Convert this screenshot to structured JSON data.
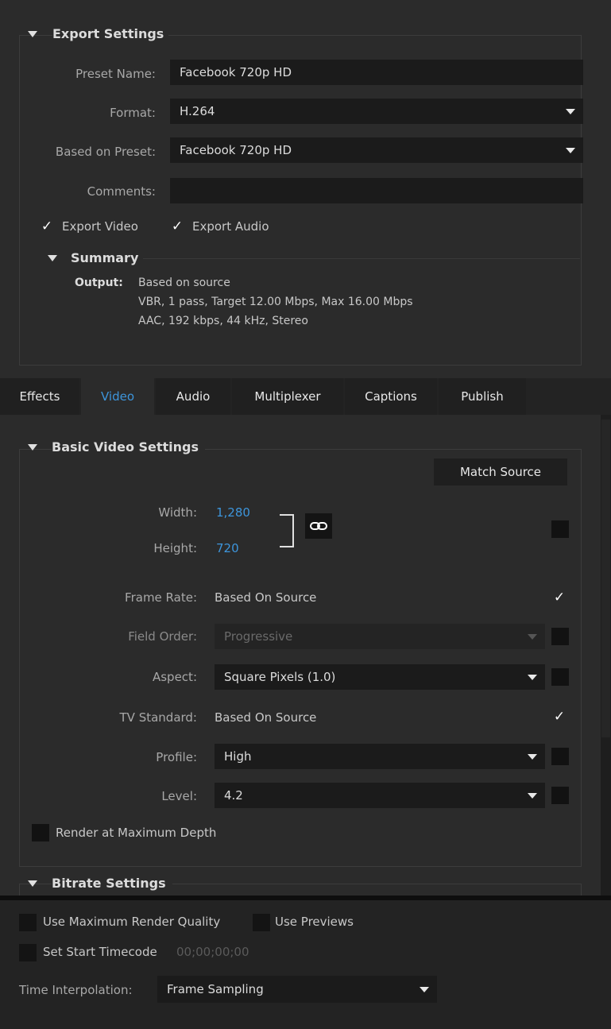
{
  "export_settings": {
    "title": "Export Settings",
    "preset_name_label": "Preset Name:",
    "preset_name_value": "Facebook 720p HD",
    "format_label": "Format:",
    "format_value": "H.264",
    "based_on_preset_label": "Based on Preset:",
    "based_on_preset_value": "Facebook 720p HD",
    "comments_label": "Comments:",
    "comments_value": "",
    "export_video_label": "Export Video",
    "export_video_checked": true,
    "export_audio_label": "Export Audio",
    "export_audio_checked": true,
    "summary": {
      "title": "Summary",
      "output_label": "Output:",
      "output_line1": "Based on source",
      "output_line2": "VBR, 1 pass, Target 12.00 Mbps, Max 16.00 Mbps",
      "output_line3": "AAC, 192 kbps, 44 kHz, Stereo"
    }
  },
  "tabs": [
    {
      "label": "Effects",
      "active": false
    },
    {
      "label": "Video",
      "active": true
    },
    {
      "label": "Audio",
      "active": false
    },
    {
      "label": "Multiplexer",
      "active": false
    },
    {
      "label": "Captions",
      "active": false
    },
    {
      "label": "Publish",
      "active": false
    }
  ],
  "basic_video": {
    "title": "Basic Video Settings",
    "match_source_label": "Match Source",
    "width_label": "Width:",
    "width_value": "1,280",
    "height_label": "Height:",
    "height_value": "720",
    "frame_rate_label": "Frame Rate:",
    "frame_rate_value": "Based On Source",
    "field_order_label": "Field Order:",
    "field_order_value": "Progressive",
    "aspect_label": "Aspect:",
    "aspect_value": "Square Pixels (1.0)",
    "tv_standard_label": "TV Standard:",
    "tv_standard_value": "Based On Source",
    "profile_label": "Profile:",
    "profile_value": "High",
    "level_label": "Level:",
    "level_value": "4.2",
    "render_max_depth_label": "Render at Maximum Depth"
  },
  "bitrate": {
    "title": "Bitrate Settings"
  },
  "bottom": {
    "use_max_render_quality_label": "Use Maximum Render Quality",
    "use_previews_label": "Use Previews",
    "set_start_timecode_label": "Set Start Timecode",
    "start_timecode_value": "00;00;00;00",
    "time_interpolation_label": "Time Interpolation:",
    "time_interpolation_value": "Frame Sampling"
  },
  "icons": {
    "disclosure": "triangle-down-icon",
    "dropdown": "chevron-down-icon",
    "link": "chain-link-icon",
    "check": "checkmark-icon"
  },
  "colors": {
    "accent_blue": "#3d95db",
    "panel_bg": "#2b2b2b",
    "field_bg": "#1b1b1b"
  }
}
